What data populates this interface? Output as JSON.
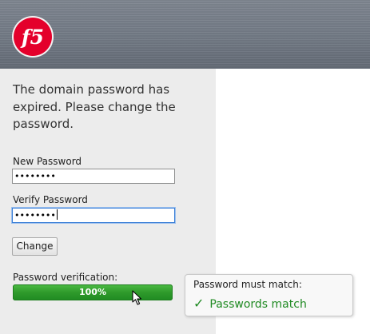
{
  "brand": {
    "logo_text": "f5",
    "accent_color": "#e4002b"
  },
  "message": "The domain password has expired. Please change the password.",
  "form": {
    "new_password_label": "New Password",
    "new_password_value": "••••••••",
    "verify_password_label": "Verify Password",
    "verify_password_value": "••••••••",
    "change_button_label": "Change"
  },
  "verification": {
    "label": "Password verification:",
    "progress_percent": 100,
    "progress_text": "100%",
    "bar_color": "#2f9a2b"
  },
  "tooltip": {
    "title": "Password must match:",
    "status_icon": "checkmark-icon",
    "status_text": "Passwords match",
    "status_color": "#1f8a22"
  }
}
